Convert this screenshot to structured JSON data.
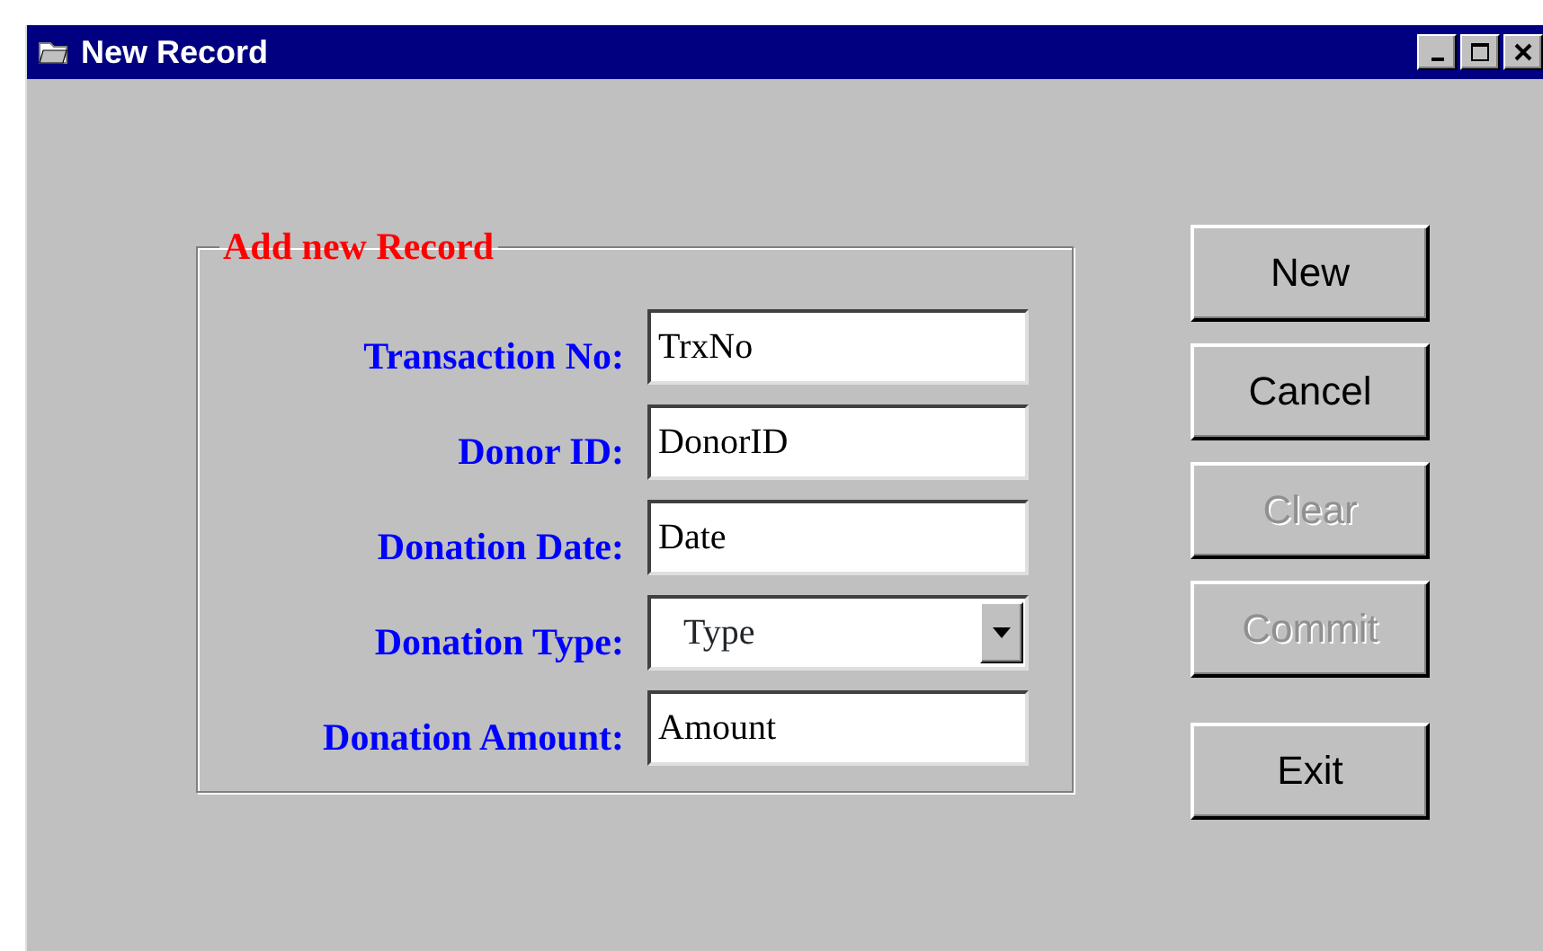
{
  "window": {
    "title": "New Record"
  },
  "group": {
    "title": "Add new Record",
    "fields": [
      {
        "label": "Transaction No:",
        "kind": "text",
        "value": "TrxNo"
      },
      {
        "label": "Donor ID:",
        "kind": "text",
        "value": "DonorID"
      },
      {
        "label": "Donation Date:",
        "kind": "text",
        "value": "Date"
      },
      {
        "label": "Donation Type:",
        "kind": "dropdown",
        "value": "Type"
      },
      {
        "label": "Donation Amount:",
        "kind": "text",
        "value": "Amount"
      }
    ]
  },
  "buttons": [
    {
      "label": "New",
      "disabled": false
    },
    {
      "label": "Cancel",
      "disabled": false
    },
    {
      "label": "Clear",
      "disabled": true
    },
    {
      "label": "Commit",
      "disabled": true
    },
    {
      "label": "Exit",
      "disabled": false
    }
  ]
}
